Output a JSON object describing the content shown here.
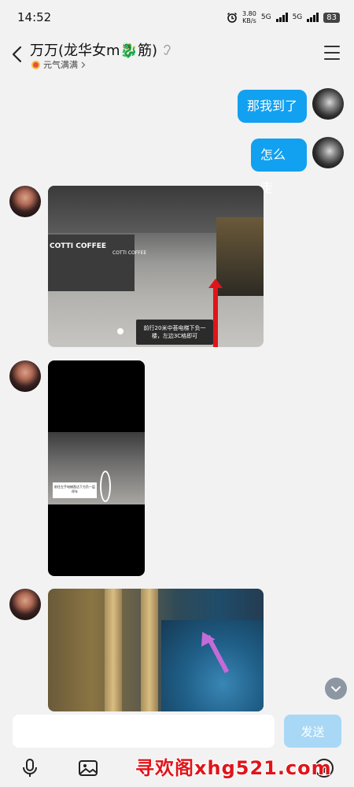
{
  "status_bar": {
    "time": "14:52",
    "speed_value": "3.80",
    "speed_unit": "KB/s",
    "net_1": "5G",
    "net_2": "5G",
    "battery": "83"
  },
  "header": {
    "title": "万万(龙华女m🐉筋)",
    "subtitle": "元气满满"
  },
  "messages": {
    "m1": "那我到了",
    "m2": "怎么走",
    "img1_store": "COTTI COFFEE",
    "img1_store2": "COTTI COFFEE",
    "img1_note": "前行20米中荟电梯下负一楼，左边3C格即可",
    "img2_note": "前往左手电梯直达下方负一层停车"
  },
  "input": {
    "placeholder": "",
    "send_label": "发送"
  },
  "watermark": "寻欢阁xhg521.com"
}
